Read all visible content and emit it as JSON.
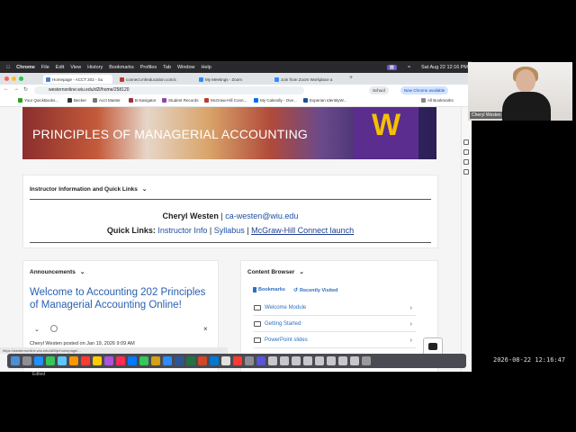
{
  "menubar": {
    "app": "Chrome",
    "items": [
      "File",
      "Edit",
      "View",
      "History",
      "Bookmarks",
      "Profiles",
      "Tab",
      "Window",
      "Help"
    ],
    "datetime": "Sat Aug 22 12:16 PM"
  },
  "tabs": [
    {
      "label": "Homepage - ACCT 202 - Su",
      "color": "#4a7bd0"
    },
    {
      "label": "connect.mheducation.com/c",
      "color": "#c0392b"
    },
    {
      "label": "My Meetings - Zoom",
      "color": "#2d8cff"
    },
    {
      "label": "Join from Zoom Workplace a",
      "color": "#2d8cff"
    }
  ],
  "address": {
    "url": "westernonline.wiu.edu/d2l/home/258120",
    "school": "School",
    "update": "New Chrome available"
  },
  "bookmarks": [
    "Your QuickBooks...",
    "Becker",
    "Acct Master",
    "B Navigator",
    "Student Records",
    "McGraw-Hill Conn...",
    "My Calendly - Ove...",
    "Experian IdentityW...",
    "All Bookmarks"
  ],
  "banner": {
    "title": "PRINCIPLES OF MANAGERIAL ACCOUNTING",
    "logo": "W"
  },
  "instructor": {
    "header": "Instructor Information and Quick Links",
    "name": "Cheryl Westen",
    "email": "ca-westen@wiu.edu",
    "quick_label": "Quick Links:",
    "links": [
      "Instructor Info",
      "Syllabus",
      "McGraw-Hill Connect launch"
    ]
  },
  "announcements": {
    "header": "Announcements",
    "title": "Welcome to Accounting 202 Principles of Managerial Accounting Online!",
    "meta": "Cheryl Westen posted on Jan 19, 2026 9:09 AM"
  },
  "content_browser": {
    "header": "Content Browser",
    "bookmarks_tab": "Bookmarks",
    "recent_tab": "Recently Visited",
    "items": [
      "Welcome Module",
      "Getting Started",
      "PowerPoint slides"
    ]
  },
  "status_url": "https://westernonline.wiu.edu/d2l/lp/homepage/...",
  "edited": "Edited",
  "video": {
    "name": "Cheryl Westen"
  },
  "timestamp": "2026-08-22 12:16:47",
  "colors": {
    "link": "#1f4fa3",
    "welcome": "#2960b0",
    "banner_purple": "#5b2d8e",
    "banner_gold": "#f5c000"
  }
}
